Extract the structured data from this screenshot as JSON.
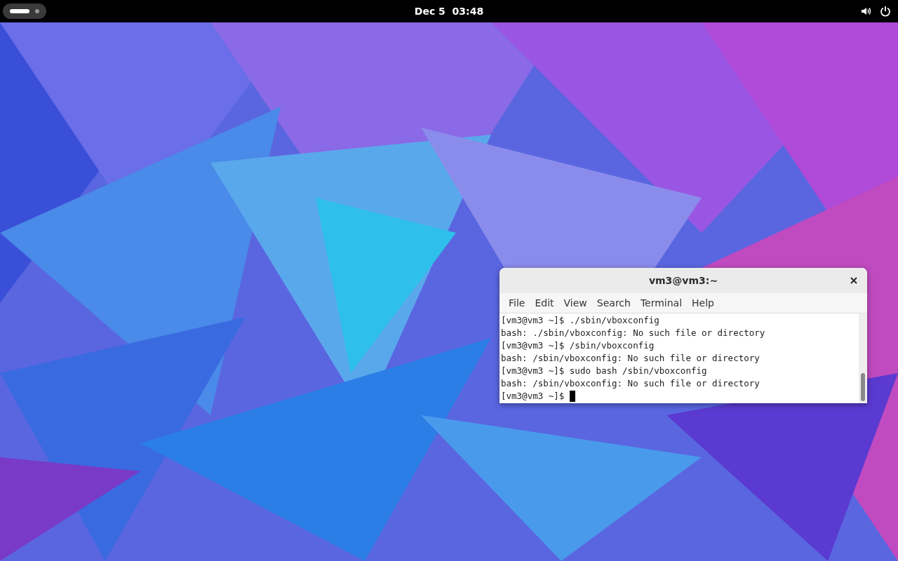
{
  "top_bar": {
    "workspaces": [
      {
        "selected": true
      },
      {
        "selected": false
      }
    ],
    "clock": "Dec 5  03:48"
  },
  "terminal": {
    "title": "vm3@vm3:~",
    "menu": [
      "File",
      "Edit",
      "View",
      "Search",
      "Terminal",
      "Help"
    ],
    "lines": [
      "[vm3@vm3 ~]$ ./sbin/vboxconfig",
      "bash: ./sbin/vboxconfig: No such file or directory",
      "[vm3@vm3 ~]$ /sbin/vboxconfig",
      "bash: /sbin/vboxconfig: No such file or directory",
      "[vm3@vm3 ~]$ sudo bash /sbin/vboxconfig",
      "bash: /sbin/vboxconfig: No such file or directory"
    ],
    "prompt": "[vm3@vm3 ~]$"
  }
}
